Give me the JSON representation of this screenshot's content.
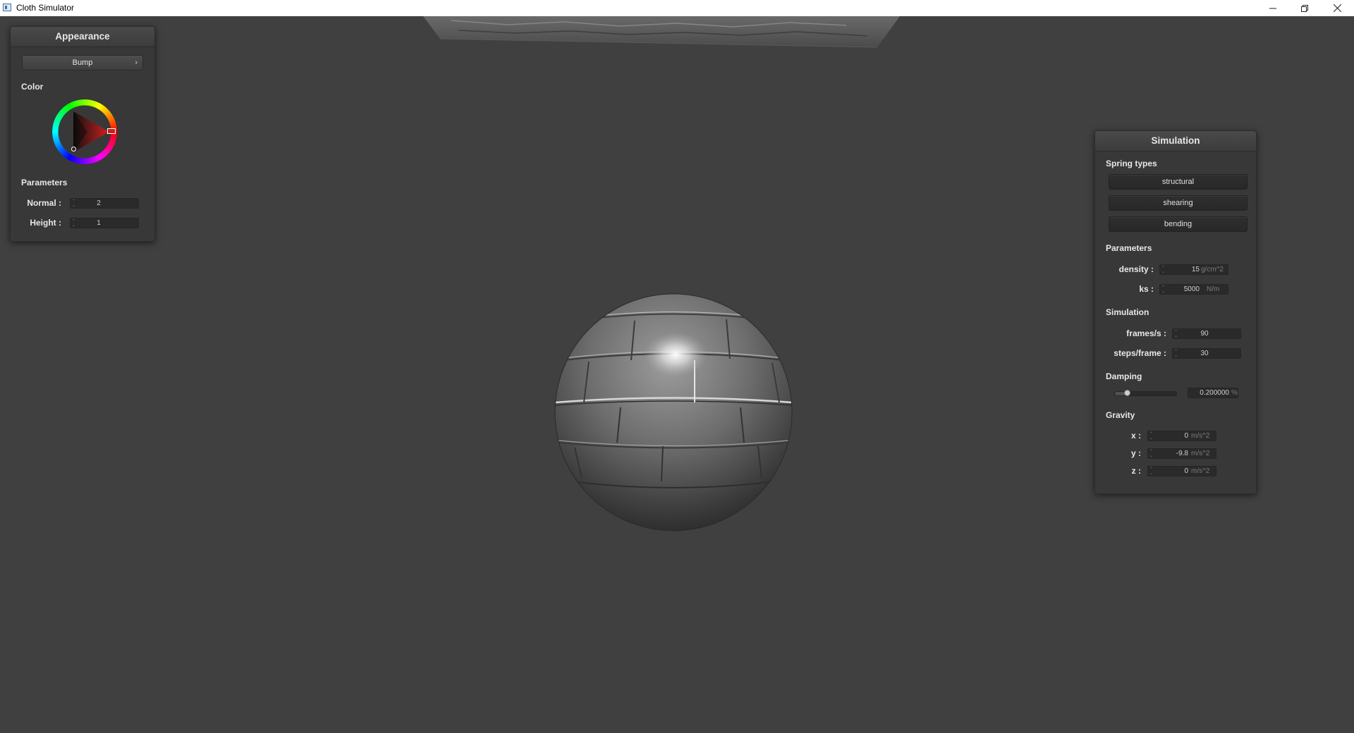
{
  "window": {
    "title": "Cloth Simulator"
  },
  "appearance": {
    "header": "Appearance",
    "shader_dropdown": "Bump",
    "color_label": "Color",
    "color_value": "#c81f1f",
    "params_label": "Parameters",
    "params": [
      {
        "label": "Normal :",
        "value": "2"
      },
      {
        "label": "Height :",
        "value": "1"
      }
    ]
  },
  "simulation": {
    "header": "Simulation",
    "spring_label": "Spring types",
    "springs": [
      "structural",
      "shearing",
      "bending"
    ],
    "params_label": "Parameters",
    "density": {
      "label": "density :",
      "value": "15",
      "unit": "g/cm^2"
    },
    "ks": {
      "label": "ks :",
      "value": "5000",
      "unit": "N/m"
    },
    "sim_label": "Simulation",
    "fps": {
      "label": "frames/s :",
      "value": "90"
    },
    "steps": {
      "label": "steps/frame :",
      "value": "30"
    },
    "damping_label": "Damping",
    "damping": {
      "value": "0.200000",
      "unit": "%",
      "level": 0.2
    },
    "gravity_label": "Gravity",
    "gravity": [
      {
        "label": "x :",
        "value": "0",
        "unit": "m/s^2"
      },
      {
        "label": "y :",
        "value": "-9.8",
        "unit": "m/s^2"
      },
      {
        "label": "z :",
        "value": "0",
        "unit": "m/s^2"
      }
    ]
  }
}
